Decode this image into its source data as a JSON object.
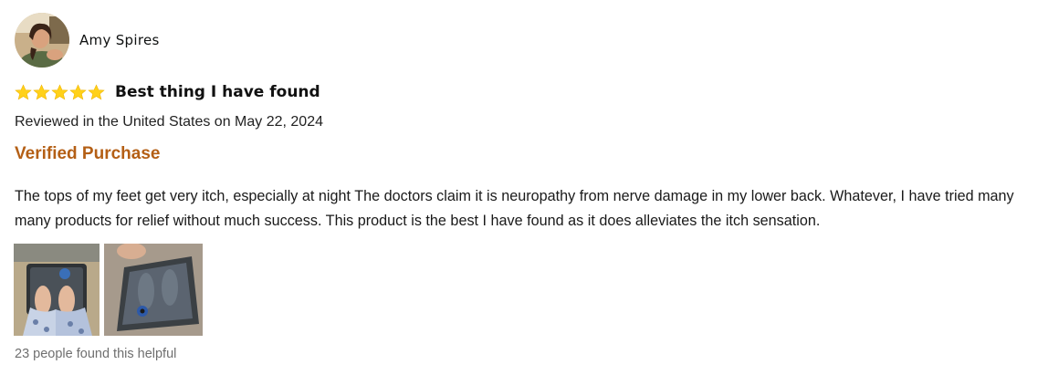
{
  "reviewer": {
    "name": "Amy Spires",
    "avatar_icon": "profile-photo"
  },
  "rating": {
    "stars": 5,
    "max": 5,
    "star_color": "#ffd11a"
  },
  "review": {
    "title": "Best thing I have found",
    "date_line": "Reviewed in the United States on May 22, 2024",
    "badge": "Verified Purchase",
    "badge_color": "#b45f15",
    "body": "The tops of my feet get very itch, especially at night The doctors claim it is neuropathy from nerve damage in my lower back. Whatever, I have tried many many products for relief without much success. This product is the best I have found as it does alleviates the itch sensation.",
    "images": [
      {
        "icon": "feet-on-massager-photo"
      },
      {
        "icon": "massager-mat-photo"
      }
    ],
    "helpful_text": "23 people found this helpful"
  }
}
